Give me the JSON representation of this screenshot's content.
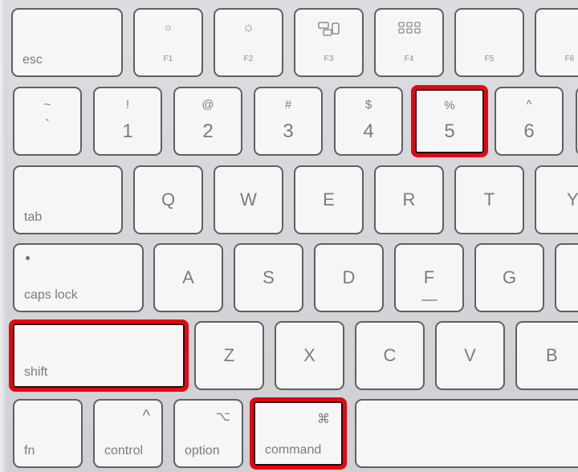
{
  "keyboard": {
    "highlight_color": "#e30613",
    "highlighted_keys": [
      "shift",
      "command",
      "5"
    ],
    "row1": {
      "esc": "esc",
      "f1": {
        "label": "F1",
        "icon": "brightness-down-icon",
        "glyph": "☼"
      },
      "f2": {
        "label": "F2",
        "icon": "brightness-up-icon",
        "glyph": "☼"
      },
      "f3": {
        "label": "F3",
        "icon": "mission-control-icon",
        "glyph": "⧉"
      },
      "f4": {
        "label": "F4",
        "icon": "launchpad-icon",
        "glyph": "⠿"
      },
      "f5": {
        "label": "F5"
      },
      "f6": {
        "label": "F6"
      }
    },
    "row2": [
      {
        "top": "~",
        "bottom": "`"
      },
      {
        "top": "!",
        "bottom": "1"
      },
      {
        "top": "@",
        "bottom": "2"
      },
      {
        "top": "#",
        "bottom": "3"
      },
      {
        "top": "$",
        "bottom": "4"
      },
      {
        "top": "%",
        "bottom": "5"
      },
      {
        "top": "^",
        "bottom": "6"
      }
    ],
    "row3": {
      "tab": "tab",
      "letters": [
        "Q",
        "W",
        "E",
        "R",
        "T",
        "Y"
      ]
    },
    "row4": {
      "caps": "caps lock",
      "letters": [
        "A",
        "S",
        "D",
        "F",
        "G"
      ]
    },
    "row5": {
      "shift": "shift",
      "letters": [
        "Z",
        "X",
        "C",
        "V",
        "B"
      ]
    },
    "row6": {
      "fn": "fn",
      "control": {
        "label": "control",
        "symbol": "^"
      },
      "option": {
        "label": "option",
        "symbol": "⌥"
      },
      "command": {
        "label": "command",
        "symbol": "⌘"
      }
    }
  }
}
